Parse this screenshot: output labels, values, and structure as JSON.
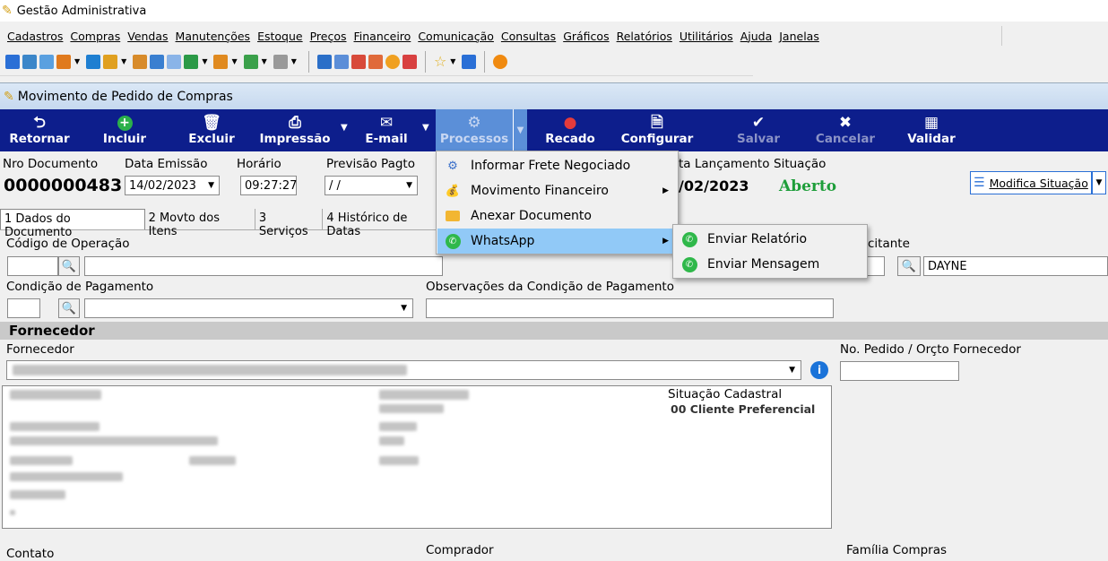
{
  "app": {
    "title": "Gestão Administrativa"
  },
  "menubar": {
    "items": [
      "Cadastros",
      "Compras",
      "Vendas",
      "Manutenções",
      "Estoque",
      "Preços",
      "Financeiro",
      "Comunicação",
      "Consultas",
      "Gráficos",
      "Relatórios",
      "Utilitários",
      "Ajuda",
      "Janelas"
    ]
  },
  "window": {
    "title": "Movimento de Pedido de Compras"
  },
  "toolbar": {
    "retornar": "Retornar",
    "incluir": "Incluir",
    "excluir": "Excluir",
    "impressao": "Impressão",
    "email": "E-mail",
    "processos": "Processos",
    "recado": "Recado",
    "configurar": "Configurar",
    "salvar": "Salvar",
    "cancelar": "Cancelar",
    "validar": "Validar"
  },
  "header": {
    "nro_label": "Nro Documento",
    "nro_value": "0000000483",
    "emissao_label": "Data Emissão",
    "emissao_value": "14/02/2023",
    "horario_label": "Horário",
    "horario_value": "09:27:27",
    "previsao_label": "Previsão Pagto",
    "previsao_value": "/ /",
    "lancamento_label": "ta Lançamento",
    "lancamento_value": "/02/2023",
    "situacao_label": "Situação",
    "situacao_value": "Aberto",
    "modifica_label": "Modifica Situação"
  },
  "tabs": [
    "1 Dados do Documento",
    "2 Movto dos Itens",
    "3 Serviços",
    "4 Histórico de Datas"
  ],
  "form": {
    "cod_operacao_label": "Código de Operação",
    "solicitante_label": "citante",
    "solicitante_value": "DAYNE",
    "cond_pagamento_label": "Condição de Pagamento",
    "obs_cond_label": "Observações da Condição de Pagamento",
    "fornecedor_section": "Fornecedor",
    "fornecedor_label": "Fornecedor",
    "pedido_forn_label": "No. Pedido / Orçto Fornecedor",
    "sit_cadastral_label": "Situação Cadastral",
    "sit_cadastral_value": "00 Cliente Preferencial",
    "contato_label": "Contato",
    "comprador_label": "Comprador",
    "familia_label": "Família Compras"
  },
  "processos_menu": {
    "items": [
      "Informar Frete Negociado",
      "Movimento Financeiro",
      "Anexar Documento",
      "WhatsApp"
    ]
  },
  "whatsapp_menu": {
    "items": [
      "Enviar Relatório",
      "Enviar Mensagem"
    ]
  },
  "colors": {
    "toolbar": "#0d1e8c",
    "situacao": "#1e9e3a",
    "highlight": "#91c9f7",
    "whatsapp": "#2fb84a"
  }
}
